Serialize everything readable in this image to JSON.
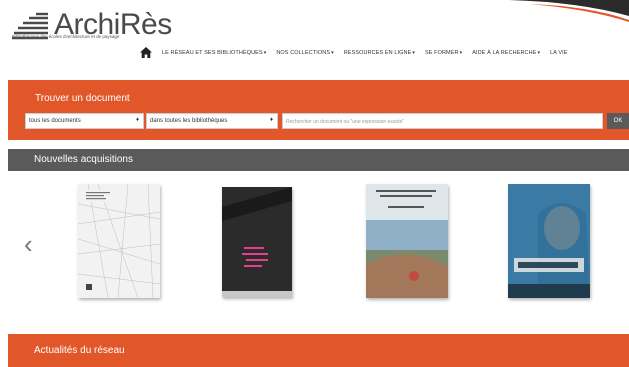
{
  "header": {
    "logo_text": "ArchiRès",
    "tagline": "Bibliothèques des écoles d'architecture et de paysage"
  },
  "nav": {
    "items": [
      {
        "label": "LE RÉSEAU ET SES BIBLIOTHÈQUES"
      },
      {
        "label": "NOS COLLECTIONS"
      },
      {
        "label": "RESSOURCES EN LIGNE"
      },
      {
        "label": "SE FORMER"
      },
      {
        "label": "AIDE À LA RECHERCHE"
      },
      {
        "label": "LA VIE"
      }
    ]
  },
  "search": {
    "title": "Trouver un document",
    "doc_type": "tous les documents",
    "library": "dans toutes les bibliothèques",
    "placeholder": "Rechercher un document ou \"une expression exacte\"",
    "submit": "OK"
  },
  "acquisitions": {
    "title": "Nouvelles acquisitions",
    "books": [
      {
        "cover_color": "#f2f2f2"
      },
      {
        "cover_color": "#2e2e2e"
      },
      {
        "cover_color": "#6f8f8a"
      },
      {
        "cover_color": "#3c7aa0"
      }
    ]
  },
  "news": {
    "title": "Actualités du réseau"
  },
  "colors": {
    "accent": "#e2572a",
    "band_dark": "#5a5a5a"
  }
}
